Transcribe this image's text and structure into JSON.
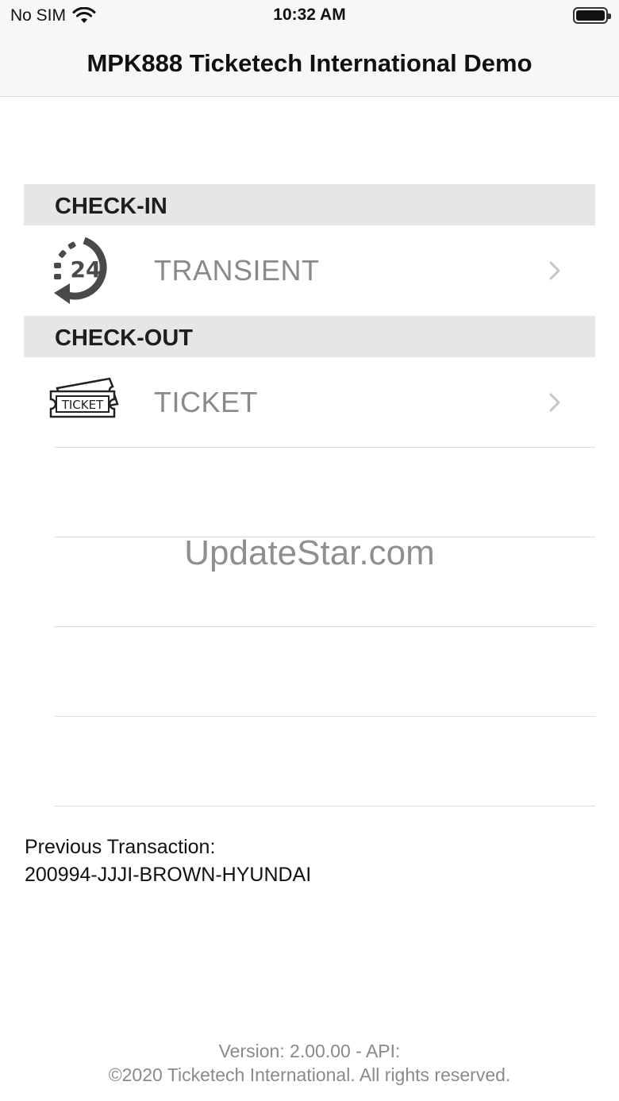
{
  "status_bar": {
    "carrier": "No SIM",
    "time": "10:32 AM",
    "wifi_icon": "wifi-icon",
    "battery_icon": "battery-full-icon"
  },
  "nav": {
    "title": "MPK888 Ticketech International Demo"
  },
  "sections": [
    {
      "header": "CHECK-IN",
      "rows": [
        {
          "label": "TRANSIENT",
          "icon": "clock-24-icon"
        }
      ]
    },
    {
      "header": "CHECK-OUT",
      "rows": [
        {
          "label": "TICKET",
          "icon": "ticket-icon",
          "icon_text": "TICKET"
        }
      ]
    }
  ],
  "watermark": "UpdateStar.com",
  "previous_transaction": {
    "label": "Previous Transaction:",
    "value": "200994-JJJI-BROWN-HYUNDAI"
  },
  "footer": {
    "version": "Version: 2.00.00 - API:",
    "copyright": "©2020 Ticketech International. All rights reserved."
  },
  "colors": {
    "bar_background": "#f7f7f7",
    "section_header": "#e6e6e6",
    "row_label": "#8a8a8a",
    "chevron": "#c4c4c8"
  }
}
